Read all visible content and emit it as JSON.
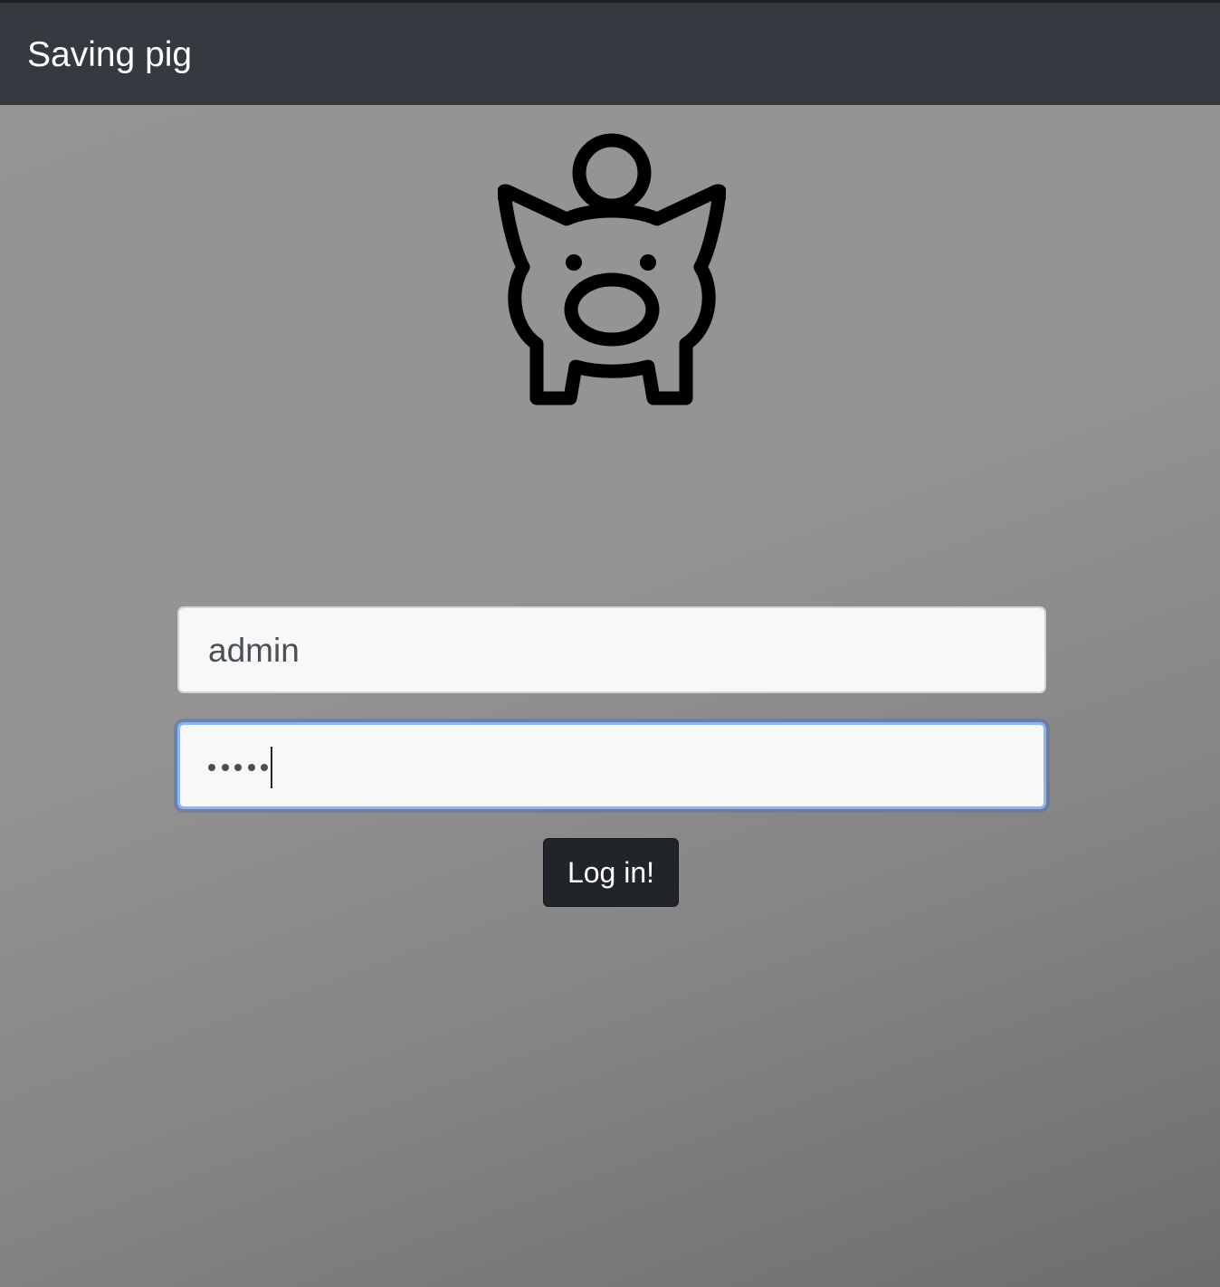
{
  "navbar": {
    "brand": "Saving pig"
  },
  "logo": {
    "icon": "piggy-bank-icon"
  },
  "form": {
    "username_value": "admin",
    "password_masked_length": 5,
    "submit_label": "Log in!"
  },
  "colors": {
    "navbar_bg": "#343a40",
    "button_bg": "#212529",
    "focus_border": "#86b7fe",
    "input_bg": "#f8f8f8"
  }
}
